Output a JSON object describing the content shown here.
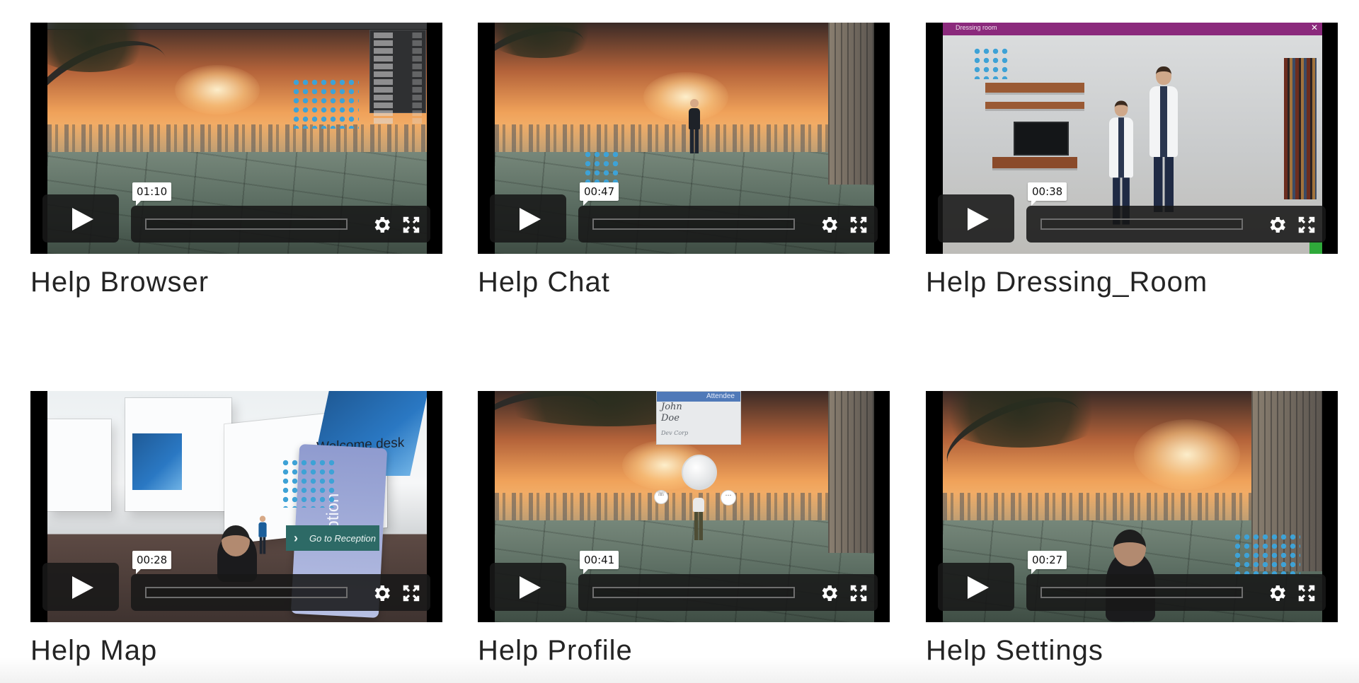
{
  "videos": [
    {
      "title": "Help Browser",
      "timecode": "01:10"
    },
    {
      "title": "Help Chat",
      "timecode": "00:47"
    },
    {
      "title": "Help Dressing_Room",
      "timecode": "00:38"
    },
    {
      "title": "Help Map",
      "timecode": "00:28"
    },
    {
      "title": "Help Profile",
      "timecode": "00:41"
    },
    {
      "title": "Help Settings",
      "timecode": "00:27"
    }
  ],
  "scenes": {
    "dressing_room_title": "Dressing room",
    "map_welcome": "Welcome desk",
    "map_vertical_sign": "eption",
    "map_go_reception": "Go to Reception",
    "profile_card_role": "Attendee",
    "profile_first_name": "John",
    "profile_last_name": "Doe",
    "profile_company": "Dev Corp"
  },
  "colors": {
    "dots_accent": "#3ea2d6",
    "control_bg": "#181818",
    "title_text": "#242424"
  },
  "icons": {
    "play": "play-icon",
    "settings": "gear-icon",
    "fullscreen": "fullscreen-icon"
  }
}
